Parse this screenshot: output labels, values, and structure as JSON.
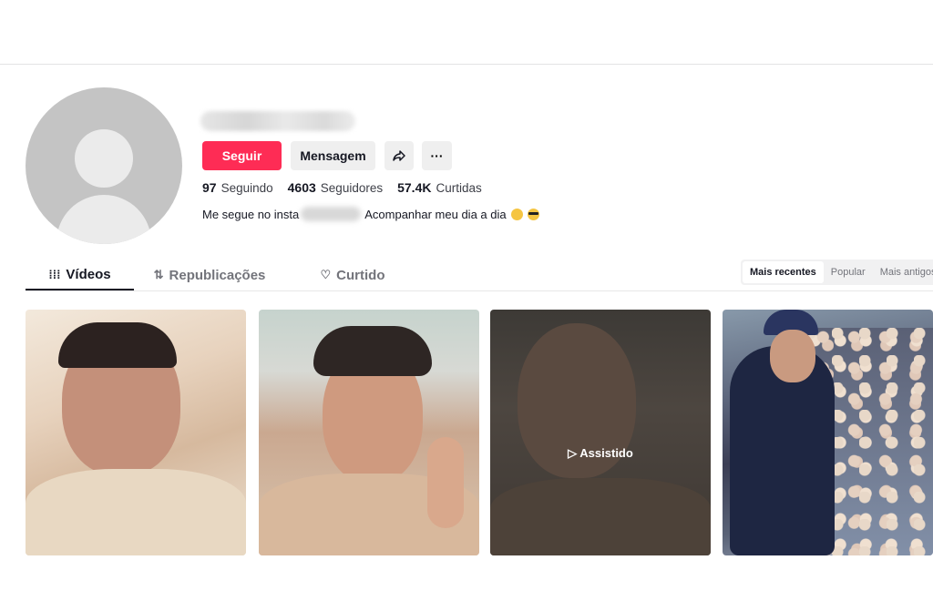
{
  "profile": {
    "follow_label": "Seguir",
    "message_label": "Mensagem",
    "more_label": "···",
    "stats": [
      {
        "value": "97",
        "label": "Seguindo"
      },
      {
        "value": "4603",
        "label": "Seguidores"
      },
      {
        "value": "57.4K",
        "label": "Curtidas"
      }
    ],
    "bio_start": "Me segue no insta",
    "bio_end": "Acompanhar meu dia a dia",
    "accent_color": "#fe2c55"
  },
  "tabs": [
    {
      "label": "Vídeos",
      "icon": "grid-icon",
      "glyph": "⁞⁞⁞",
      "active": true
    },
    {
      "label": "Republicações",
      "icon": "repost-icon",
      "glyph": "⇅",
      "active": false
    },
    {
      "label": "Curtido",
      "icon": "heart-icon",
      "glyph": "♡",
      "active": false
    }
  ],
  "sort": {
    "options": [
      "Mais recentes",
      "Popular",
      "Mais antigos"
    ],
    "active": "Mais recentes"
  },
  "videos": {
    "watched_label": "▷ Assistido"
  }
}
